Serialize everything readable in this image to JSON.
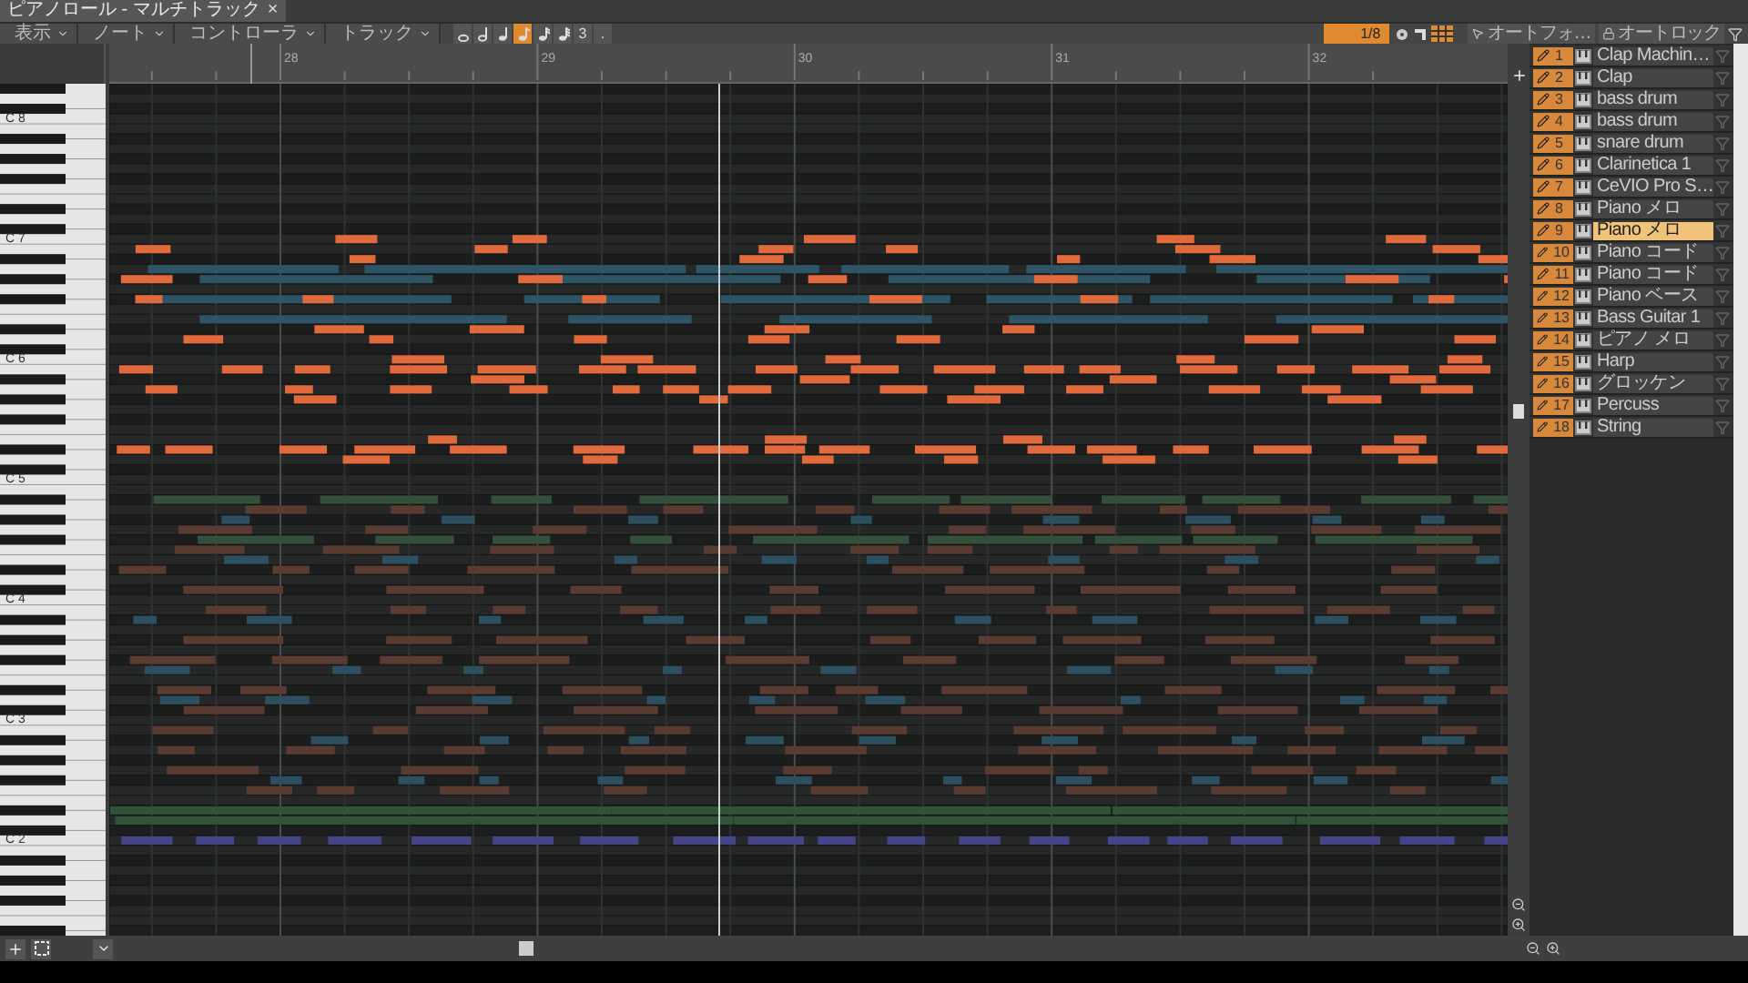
{
  "tab": {
    "title": "ピアノロール - マルチトラック",
    "close": "×"
  },
  "menus": [
    "表示",
    "ノート",
    "コントローラ",
    "トラック"
  ],
  "note_buttons": [
    {
      "kind": "whole",
      "selected": false
    },
    {
      "kind": "half",
      "selected": false
    },
    {
      "kind": "quarter",
      "selected": false
    },
    {
      "kind": "eighth",
      "selected": true
    },
    {
      "kind": "sixteenth",
      "selected": false
    },
    {
      "kind": "thirtysecond",
      "selected": false
    },
    {
      "kind": "triplet",
      "label": "3",
      "selected": false
    },
    {
      "kind": "dot",
      "label": ".",
      "selected": false
    }
  ],
  "quantize": "1/8",
  "panel_header": {
    "auto_follow": "オートフォ…",
    "auto_lock": "オートロック"
  },
  "ruler": [
    "28",
    "29",
    "30",
    "31",
    "32"
  ],
  "octaves": [
    "C 8",
    "C 7",
    "C 6",
    "C 5",
    "C 4",
    "C 3",
    "C 2"
  ],
  "tracks": [
    {
      "number": "1",
      "name": "Clap Machin…",
      "selected": false
    },
    {
      "number": "2",
      "name": "Clap",
      "selected": false
    },
    {
      "number": "3",
      "name": "bass drum",
      "selected": false
    },
    {
      "number": "4",
      "name": "bass drum",
      "selected": false
    },
    {
      "number": "5",
      "name": "snare drum",
      "selected": false
    },
    {
      "number": "6",
      "name": "Clarinetica 1",
      "selected": false
    },
    {
      "number": "7",
      "name": "CeVIO Pro S…",
      "selected": false
    },
    {
      "number": "8",
      "name": "Piano メロ",
      "selected": false
    },
    {
      "number": "9",
      "name": "Piano メロ",
      "selected": true
    },
    {
      "number": "10",
      "name": "Piano コード",
      "selected": false
    },
    {
      "number": "11",
      "name": "Piano コード",
      "selected": false
    },
    {
      "number": "12",
      "name": "Piano ベース",
      "selected": false
    },
    {
      "number": "13",
      "name": "Bass Guitar 1",
      "selected": false
    },
    {
      "number": "14",
      "name": "ピアノ メロ",
      "selected": false
    },
    {
      "number": "15",
      "name": "Harp",
      "selected": false
    },
    {
      "number": "16",
      "name": "グロッケン",
      "selected": false
    },
    {
      "number": "17",
      "name": "Percuss",
      "selected": false
    },
    {
      "number": "18",
      "name": "String",
      "selected": false
    }
  ]
}
